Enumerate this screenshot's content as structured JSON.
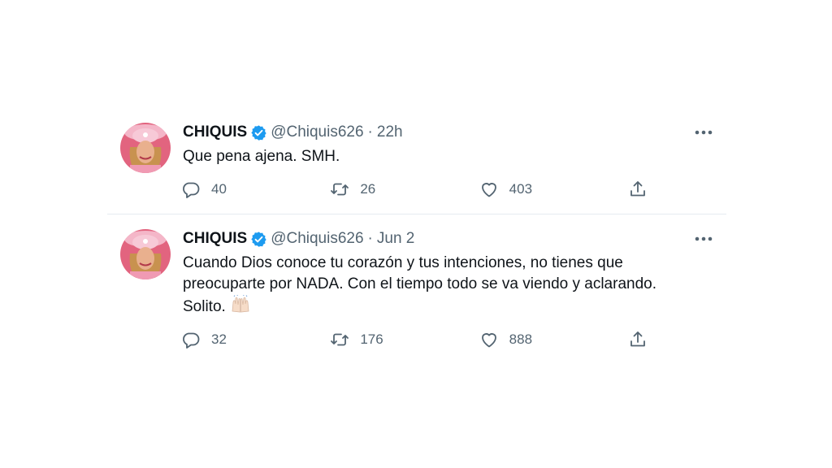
{
  "tweets": [
    {
      "name": "CHIQUIS",
      "handle": "@Chiquis626",
      "separator": "·",
      "time": "22h",
      "text": "Que pena ajena. SMH.",
      "emoji": "",
      "replies": "40",
      "retweets": "26",
      "likes": "403"
    },
    {
      "name": "CHIQUIS",
      "handle": "@Chiquis626",
      "separator": "·",
      "time": "Jun 2",
      "text": "Cuando Dios conoce tu corazón y tus intenciones, no tienes que preocuparte por NADA. Con el tiempo todo se va viendo y aclarando. Solito. ",
      "emoji": "raising-hands",
      "replies": "32",
      "retweets": "176",
      "likes": "888"
    }
  ],
  "icons": {
    "verified": "verified-badge-icon",
    "more": "more-horizontal-icon",
    "reply": "reply-icon",
    "retweet": "retweet-icon",
    "like": "heart-icon",
    "share": "share-icon"
  },
  "colors": {
    "verified_blue": "#1d9bf0",
    "secondary_text": "#536471",
    "avatar_pink": "#e85a86"
  }
}
